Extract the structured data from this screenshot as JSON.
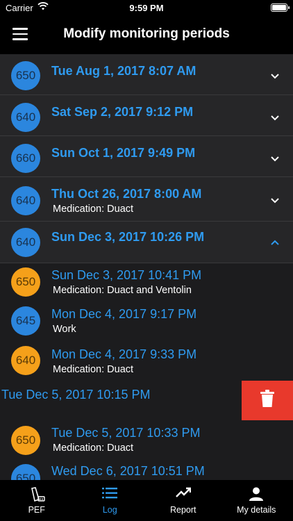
{
  "status_bar": {
    "carrier": "Carrier",
    "time": "9:59 PM"
  },
  "nav": {
    "title": "Modify monitoring periods"
  },
  "periods": [
    {
      "badge": "650",
      "date": "Tue Aug 1, 2017 8:07 AM",
      "sub": ""
    },
    {
      "badge": "640",
      "date": "Sat Sep 2, 2017 9:12 PM",
      "sub": ""
    },
    {
      "badge": "660",
      "date": "Sun Oct 1, 2017 9:49 PM",
      "sub": ""
    },
    {
      "badge": "640",
      "date": "Thu Oct 26, 2017 8:00 AM",
      "sub": "Medication: Duact"
    },
    {
      "badge": "640",
      "date": "Sun Dec 3, 2017 10:26 PM",
      "sub": ""
    }
  ],
  "entries": [
    {
      "badge": "650",
      "date": "Sun Dec 3, 2017 10:41 PM",
      "sub": "Medication: Duact and Ventolin",
      "color": "orange"
    },
    {
      "badge": "645",
      "date": "Mon Dec 4, 2017 9:17 PM",
      "sub": "Work",
      "color": "blue"
    },
    {
      "badge": "640",
      "date": "Mon Dec 4, 2017 9:33 PM",
      "sub": "Medication: Duact",
      "color": "orange"
    },
    {
      "badge": "",
      "date": "Tue Dec 5, 2017 10:15 PM",
      "sub": "",
      "color": ""
    },
    {
      "badge": "650",
      "date": "Tue Dec 5, 2017 10:33 PM",
      "sub": "Medication: Duact",
      "color": "orange"
    },
    {
      "badge": "650",
      "date": "Wed Dec 6, 2017 10:51 PM",
      "sub": "",
      "color": "blue"
    }
  ],
  "colors": {
    "accent": "#2f9bf0",
    "orange": "#f5a01a",
    "blue": "#2b86de",
    "delete": "#e8392c"
  },
  "tabs": [
    {
      "label": "PEF",
      "icon": "inhaler-icon"
    },
    {
      "label": "Log",
      "icon": "list-icon"
    },
    {
      "label": "Report",
      "icon": "trend-icon"
    },
    {
      "label": "My details",
      "icon": "person-icon"
    }
  ]
}
